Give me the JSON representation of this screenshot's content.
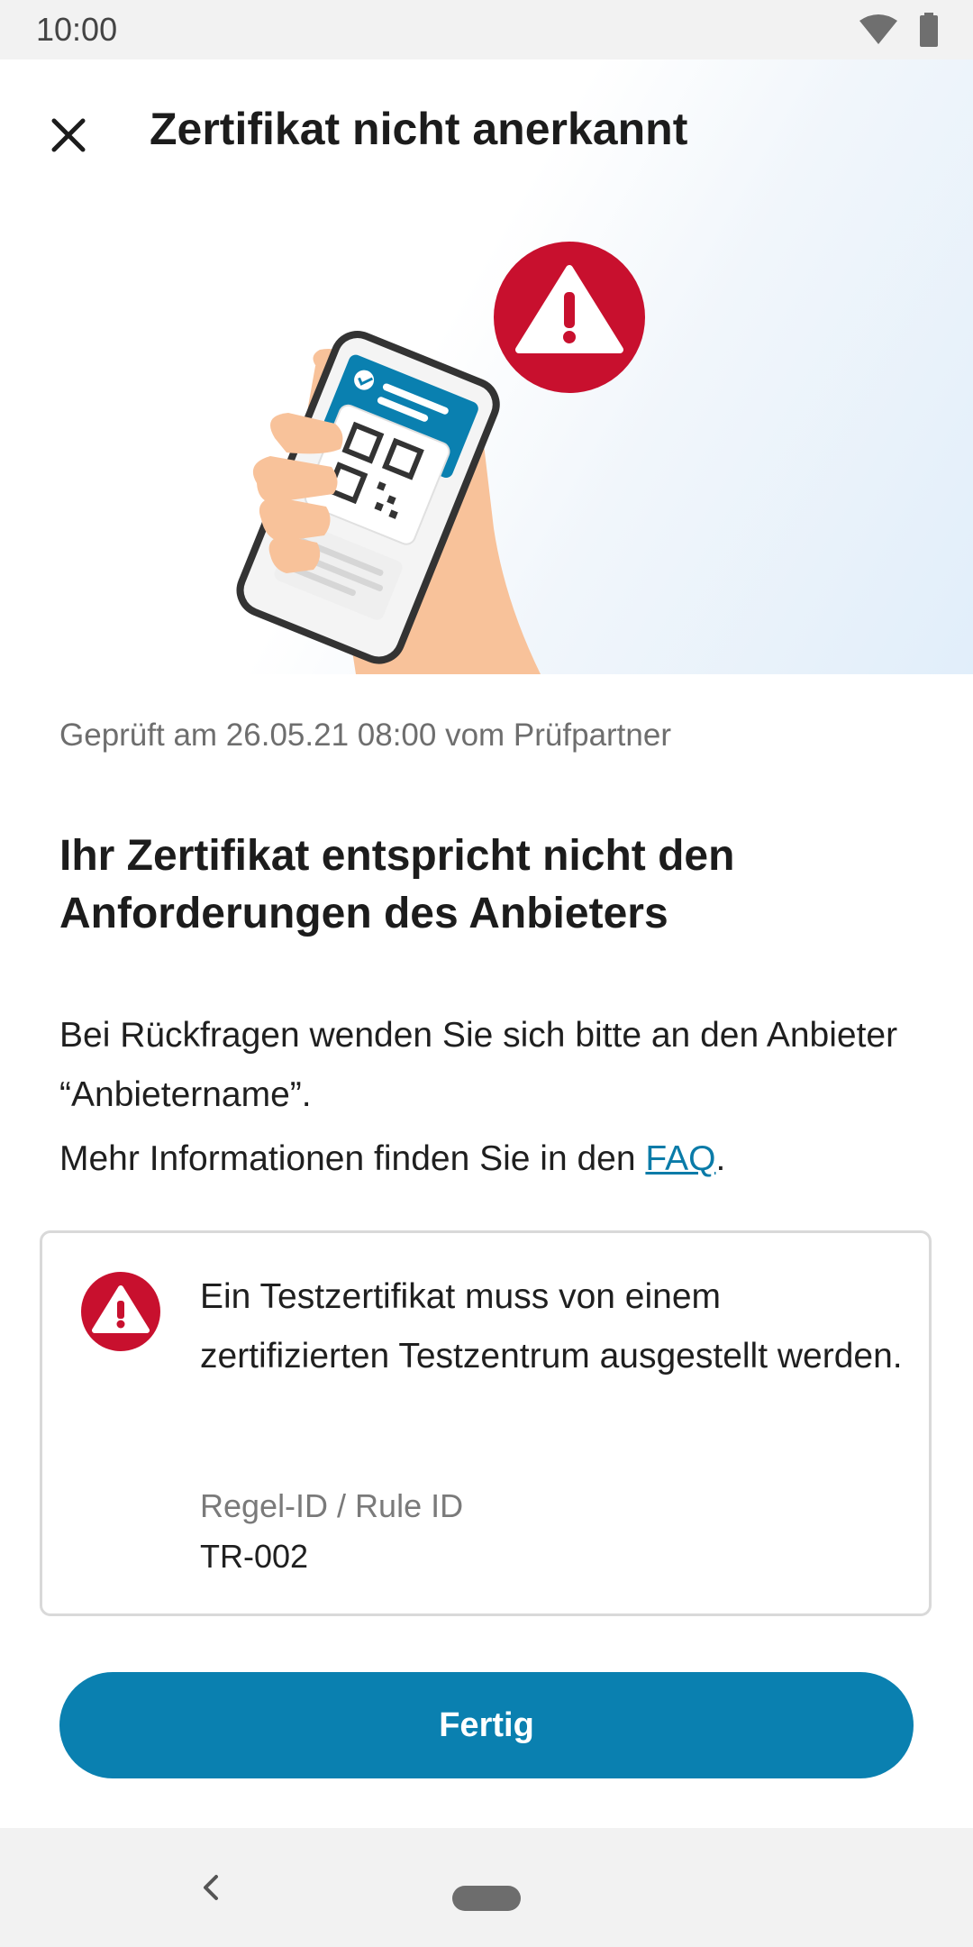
{
  "status_bar": {
    "time": "10:00",
    "icons": [
      "wifi-icon",
      "battery-icon"
    ]
  },
  "header": {
    "title": "Zertifikat nicht anerkannt",
    "close_icon": "close-icon"
  },
  "colors": {
    "accent": "#0a80b0",
    "warning_red": "#c8102e",
    "link": "#0a7ba8",
    "skin": "#f8c29a"
  },
  "main": {
    "checked_info": "Geprüft am 26.05.21 08:00 vom Prüfpartner",
    "headline": "Ihr Zertifikat entspricht nicht den Anforderungen des Anbieters",
    "contact_text": "Bei Rückfragen wenden Sie sich bitte an den Anbieter “Anbietername”.",
    "faq_prefix": "Mehr Informationen finden Sie in den ",
    "faq_link": "FAQ",
    "faq_suffix": "."
  },
  "rule_card": {
    "icon": "warning-icon",
    "message": "Ein Testzertifikat muss von einem zertifizierten Testzentrum ausgestellt werden.",
    "rule_label": "Regel-ID / Rule ID",
    "rule_value": "TR-002"
  },
  "actions": {
    "done_label": "Fertig"
  },
  "nav_bar": {
    "back_icon": "back-icon",
    "home_icon": "home-pill-icon"
  }
}
